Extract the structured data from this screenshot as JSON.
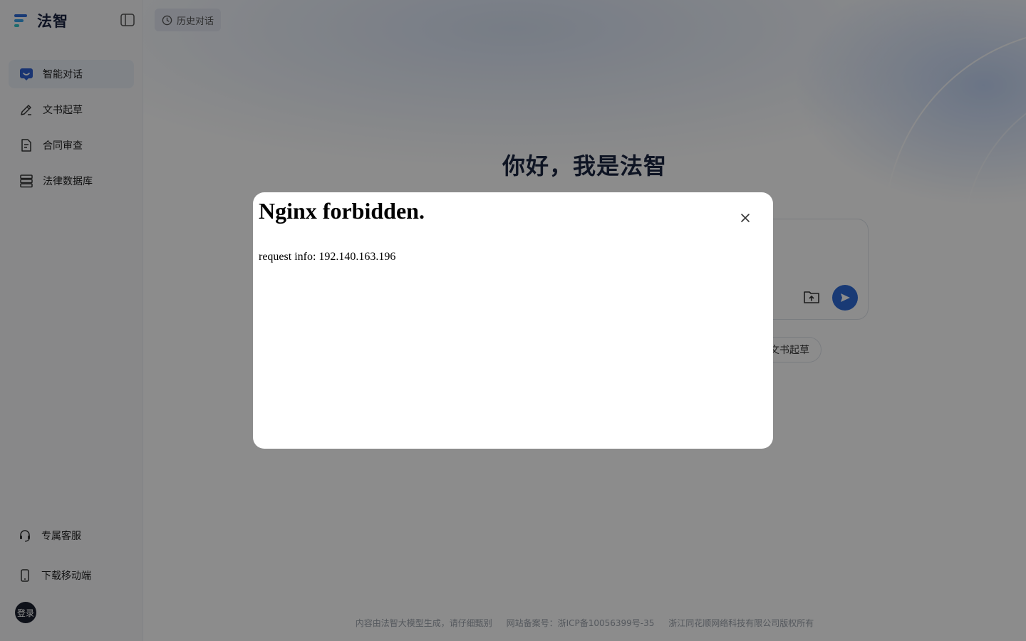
{
  "app": {
    "name": "法智"
  },
  "sidebar": {
    "items": [
      {
        "label": "智能对话",
        "icon": "chat-bubble-icon",
        "active": true
      },
      {
        "label": "文书起草",
        "icon": "pen-edit-icon",
        "active": false
      },
      {
        "label": "合同审查",
        "icon": "document-check-icon",
        "active": false
      },
      {
        "label": "法律数据库",
        "icon": "database-icon",
        "active": false
      }
    ],
    "bottom": [
      {
        "label": "专属客服",
        "icon": "headset-icon"
      },
      {
        "label": "下载移动端",
        "icon": "phone-icon"
      }
    ],
    "login_label": "登录"
  },
  "main": {
    "history_label": "历史对话",
    "greeting": "你好，我是法智",
    "chip_label": "文书起草",
    "footer": {
      "disclaimer": "内容由法智大模型生成，请仔细甄别",
      "icp": "网站备案号：浙ICP备10056399号-35",
      "copyright": "浙江同花顺网络科技有限公司版权所有"
    }
  },
  "modal": {
    "title": "Nginx forbidden.",
    "info": "request info: 192.140.163.196"
  },
  "colors": {
    "accent": "#2f6bd6",
    "sidebar_bg": "#f7f8fa",
    "title": "#1b2541"
  }
}
